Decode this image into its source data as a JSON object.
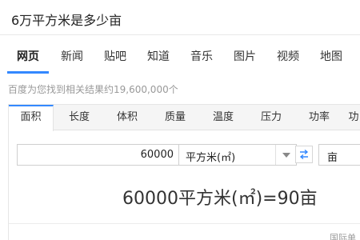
{
  "search": {
    "query": "6万平方米是多少亩"
  },
  "nav": {
    "tabs": [
      {
        "label": "网页",
        "active": true
      },
      {
        "label": "新闻"
      },
      {
        "label": "贴吧"
      },
      {
        "label": "知道"
      },
      {
        "label": "音乐"
      },
      {
        "label": "图片"
      },
      {
        "label": "视频"
      },
      {
        "label": "地图"
      }
    ]
  },
  "results": {
    "count_text": "百度为您找到相关结果约19,600,000个"
  },
  "converter": {
    "unit_tabs": [
      {
        "label": "面积",
        "active": true
      },
      {
        "label": "长度"
      },
      {
        "label": "体积"
      },
      {
        "label": "质量"
      },
      {
        "label": "温度"
      },
      {
        "label": "压力"
      },
      {
        "label": "功率"
      },
      {
        "label": "功"
      }
    ],
    "input_value": "60000",
    "from_unit": "平方米(㎡)",
    "to_unit": "亩",
    "result_text": "60000平方米(㎡)=90亩",
    "footnote": "国际单"
  },
  "colors": {
    "accent": "#3388ff",
    "muted": "#999999"
  }
}
